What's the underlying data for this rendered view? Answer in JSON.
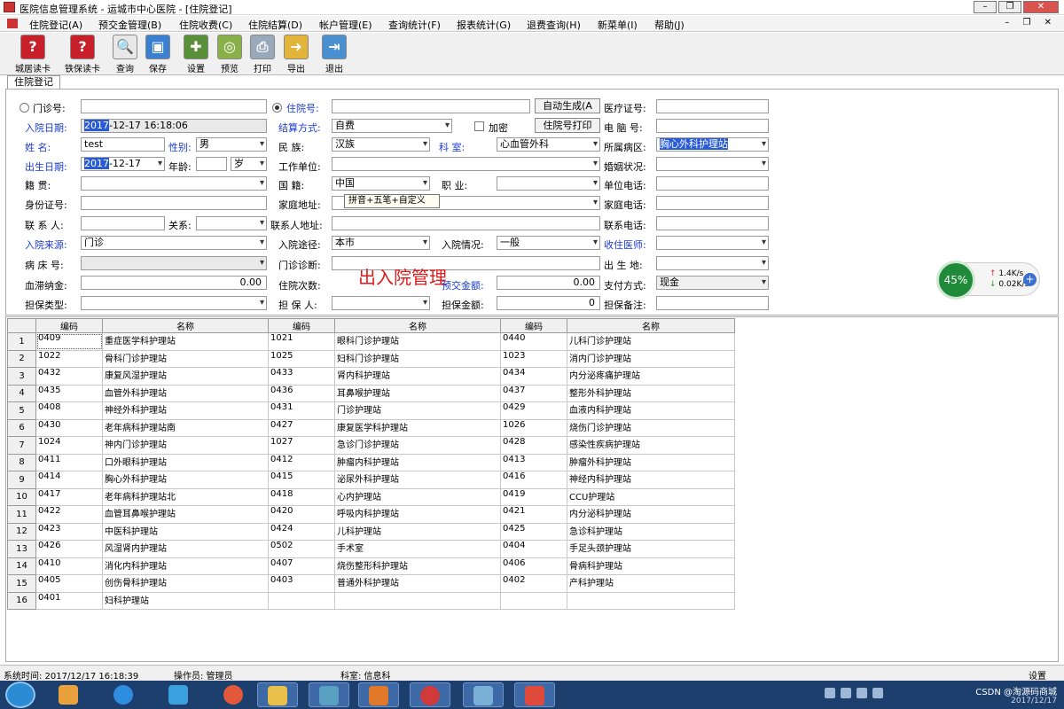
{
  "window": {
    "title": "医院信息管理系统   -   运城市中心医院 - [住院登记]"
  },
  "menu": [
    "住院登记(A)",
    "预交金管理(B)",
    "住院收费(C)",
    "住院结算(D)",
    "帐户管理(E)",
    "查询统计(F)",
    "报表统计(G)",
    "退费查询(H)",
    "新菜单(I)",
    "帮助(J)"
  ],
  "toolbar": [
    "城居读卡",
    "铁保读卡",
    "查询",
    "保存",
    "设置",
    "预览",
    "打印",
    "导出",
    "退出"
  ],
  "tab": "住院登记",
  "form": {
    "outpatient_no_label": "门诊号:",
    "inpatient_no_label": "住院号:",
    "auto_generate_button": "自动生成(A",
    "medical_card_label": "医疗证号:",
    "admission_date_label": "入院日期:",
    "admission_date_hl": "2017",
    "admission_date_rest": "-12-17 16:18:06",
    "settlement_label": "结算方式:",
    "settlement_value": "自费",
    "encrypt_label": "加密",
    "print_inpatient_button": "住院号打印",
    "computer_no_label": "电 脑 号:",
    "name_label": "姓    名:",
    "name_value": "test",
    "gender_label": "性别:",
    "gender_value": "男",
    "ethnicity_label": "民    族:",
    "ethnicity_value": "汉族",
    "dept_label": "科    室:",
    "dept_value": "心血管外科",
    "ward_label": "所属病区:",
    "ward_value": "胸心外科护理站",
    "birth_label": "出生日期:",
    "birth_hl": "2017",
    "birth_rest": "-12-17",
    "age_label": "年龄:",
    "age_unit": "岁",
    "work_unit_label": "工作单位:",
    "marital_label": "婚姻状况:",
    "native_label": "籍    贯:",
    "nationality_label": "国    籍:",
    "nationality_value": "中国",
    "occupation_label": "职    业:",
    "work_phone_label": "单位电话:",
    "id_label": "身份证号:",
    "home_addr_label": "家庭地址:",
    "home_phone_label": "家庭电话:",
    "contact_label": "联 系 人:",
    "relation_label": "关系:",
    "contact_addr_label": "联系人地址:",
    "contact_phone_label": "联系电话:",
    "source_label": "入院来源:",
    "source_value": "门诊",
    "route_label": "入院途径:",
    "route_value": "本市",
    "condition_label": "入院情况:",
    "condition_value": "一般",
    "doctor_label": "收住医师:",
    "bed_label": "病 床 号:",
    "diagnosis_label": "门诊诊断:",
    "birthplace_label": "出 生 地:",
    "stagnant_label": "血滞纳金:",
    "stagnant_value": "0.00",
    "admit_count_label": "住院次数:",
    "deposit_label": "预交金额:",
    "deposit_value": "0.00",
    "pay_label": "支付方式:",
    "pay_value": "现金",
    "guarantee_type_label": "担保类型:",
    "guarantor_label": "担 保 人:",
    "guarantee_amount_label": "担保金额:",
    "guarantee_amount_value": "0",
    "guarantee_note_label": "担保备注:"
  },
  "tooltip": "拼音+五笔+自定义",
  "overlay_title": "出入院管理",
  "speed_widget": {
    "percent": "45%",
    "up": "1.4K/s",
    "down": "0.02K/s"
  },
  "grid": {
    "headers": [
      "编码",
      "名称",
      "编码",
      "名称",
      "编码",
      "名称"
    ],
    "rows": [
      [
        "1",
        "0409",
        "重症医学科护理站",
        "1021",
        "眼科门诊护理站",
        "0440",
        "儿科门诊护理站"
      ],
      [
        "2",
        "1022",
        "骨科门诊护理站",
        "1025",
        "妇科门诊护理站",
        "1023",
        "消内门诊护理站"
      ],
      [
        "3",
        "0432",
        "康复风湿护理站",
        "0433",
        "肾内科护理站",
        "0434",
        "内分泌疼痛护理站"
      ],
      [
        "4",
        "0435",
        "血管外科护理站",
        "0436",
        "耳鼻喉护理站",
        "0437",
        "整形外科护理站"
      ],
      [
        "5",
        "0408",
        "神经外科护理站",
        "0431",
        "门诊护理站",
        "0429",
        "血液内科护理站"
      ],
      [
        "6",
        "0430",
        "老年病科护理站南",
        "0427",
        "康复医学科护理站",
        "1026",
        "烧伤门诊护理站"
      ],
      [
        "7",
        "1024",
        "神内门诊护理站",
        "1027",
        "急诊门诊护理站",
        "0428",
        "感染性疾病护理站"
      ],
      [
        "8",
        "0411",
        "口外眼科护理站",
        "0412",
        "肿瘤内科护理站",
        "0413",
        "肿瘤外科护理站"
      ],
      [
        "9",
        "0414",
        "胸心外科护理站",
        "0415",
        "泌尿外科护理站",
        "0416",
        "神经内科护理站"
      ],
      [
        "10",
        "0417",
        "老年病科护理站北",
        "0418",
        "心内护理站",
        "0419",
        "CCU护理站"
      ],
      [
        "11",
        "0422",
        "血管耳鼻喉护理站",
        "0420",
        "呼吸内科护理站",
        "0421",
        "内分泌科护理站"
      ],
      [
        "12",
        "0423",
        "中医科护理站",
        "0424",
        "儿科护理站",
        "0425",
        "急诊科护理站"
      ],
      [
        "13",
        "0426",
        "风湿肾内护理站",
        "0502",
        "手术室",
        "0404",
        "手足头颈护理站"
      ],
      [
        "14",
        "0410",
        "消化内科护理站",
        "0407",
        "烧伤整形科护理站",
        "0406",
        "骨病科护理站"
      ],
      [
        "15",
        "0405",
        "创伤骨科护理站",
        "0403",
        "普通外科护理站",
        "0402",
        "产科护理站"
      ],
      [
        "16",
        "0401",
        "妇科护理站",
        "",
        "",
        "",
        ""
      ]
    ]
  },
  "status": {
    "time": "系统时间: 2017/12/17 16:18:39",
    "operator": "操作员: 管理员",
    "dept": "科室: 信息科",
    "settings": "设置"
  },
  "taskbar": {
    "watermark": "CSDN @淘源码商城",
    "date": "2017/12/17"
  }
}
